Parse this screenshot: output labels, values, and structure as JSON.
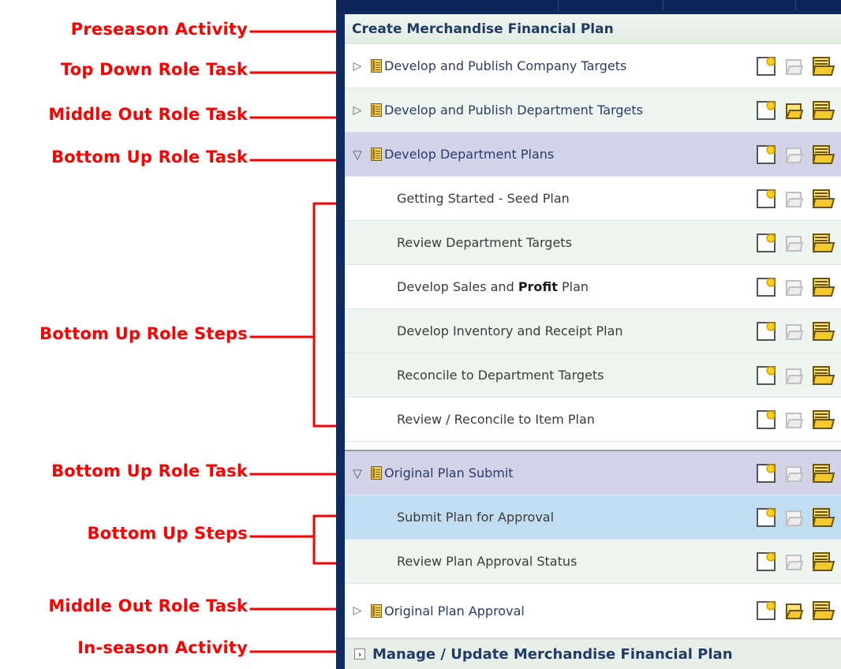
{
  "annotations": {
    "preseason_activity": "Preseason Activity",
    "top_down_role_task": "Top Down Role Task",
    "middle_out_role_task_1": "Middle Out Role Task",
    "bottom_up_role_task_1": "Bottom Up Role Task",
    "bottom_up_role_steps": "Bottom Up Role Steps",
    "bottom_up_role_task_2": "Bottom Up Role Task",
    "bottom_up_steps": "Bottom Up Steps",
    "middle_out_role_task_2": "Middle Out Role Task",
    "in_season_activity": "In-season Activity"
  },
  "panel": {
    "activity_title": "Create Merchandise Financial Plan",
    "tasks": [
      {
        "label": "Develop and Publish Company Targets",
        "expanded": false
      },
      {
        "label": "Develop and Publish Department Targets",
        "expanded": false
      },
      {
        "label": "Develop Department Plans",
        "expanded": true
      }
    ],
    "department_steps": [
      "Getting Started - Seed Plan",
      "Review Department Targets",
      "Review / Reconcile to Item Plan",
      "Develop Inventory and Receipt Plan",
      "Reconcile to Department Targets"
    ],
    "sales_profit_step": {
      "prefix": "Develop Sales and ",
      "bold": "Profit",
      "suffix": " Plan"
    },
    "submit_task": {
      "label": "Original Plan Submit",
      "expanded": true
    },
    "submit_steps": [
      "Submit Plan for Approval",
      "Review Plan Approval Status"
    ],
    "approval_task": {
      "label": "Original Plan Approval",
      "expanded": false
    },
    "next_activity_title": "Manage / Update Merchandise Financial Plan"
  },
  "icons": {
    "new": "new-document-icon",
    "open": "open-icon",
    "open_recent": "open-recent-icon"
  },
  "colors": {
    "annotation": "#ff0000",
    "frame": "#0f2a5e",
    "selected_task": "#d2d3e6",
    "selected_step": "#c0ddf2"
  }
}
